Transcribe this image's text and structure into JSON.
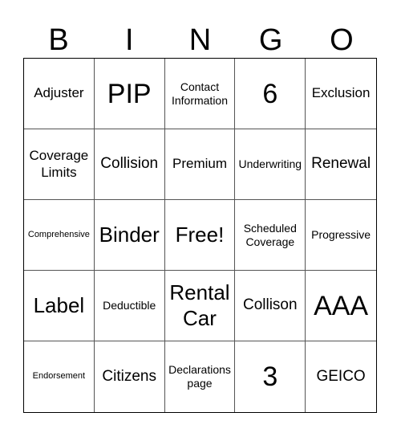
{
  "header": [
    "B",
    "I",
    "N",
    "G",
    "O"
  ],
  "cells": [
    {
      "text": "Adjuster",
      "size": "s-n"
    },
    {
      "text": "PIP",
      "size": "s-xl"
    },
    {
      "text": "Contact Information",
      "size": "s-s"
    },
    {
      "text": "6",
      "size": "s-xl"
    },
    {
      "text": "Exclusion",
      "size": "s-n"
    },
    {
      "text": "Coverage Limits",
      "size": "s-n"
    },
    {
      "text": "Collision",
      "size": "s-m"
    },
    {
      "text": "Premium",
      "size": "s-n"
    },
    {
      "text": "Underwriting",
      "size": "s-s"
    },
    {
      "text": "Renewal",
      "size": "s-m"
    },
    {
      "text": "Comprehensive",
      "size": "s-xs"
    },
    {
      "text": "Binder",
      "size": "s-l"
    },
    {
      "text": "Free!",
      "size": "s-l"
    },
    {
      "text": "Scheduled Coverage",
      "size": "s-s"
    },
    {
      "text": "Progressive",
      "size": "s-s"
    },
    {
      "text": "Label",
      "size": "s-l"
    },
    {
      "text": "Deductible",
      "size": "s-s"
    },
    {
      "text": "Rental Car",
      "size": "s-l"
    },
    {
      "text": "Collison",
      "size": "s-m"
    },
    {
      "text": "AAA",
      "size": "s-xl"
    },
    {
      "text": "Endorsement",
      "size": "s-xs"
    },
    {
      "text": "Citizens",
      "size": "s-m"
    },
    {
      "text": "Declarations page",
      "size": "s-s"
    },
    {
      "text": "3",
      "size": "s-xl"
    },
    {
      "text": "GEICO",
      "size": "s-m"
    }
  ]
}
